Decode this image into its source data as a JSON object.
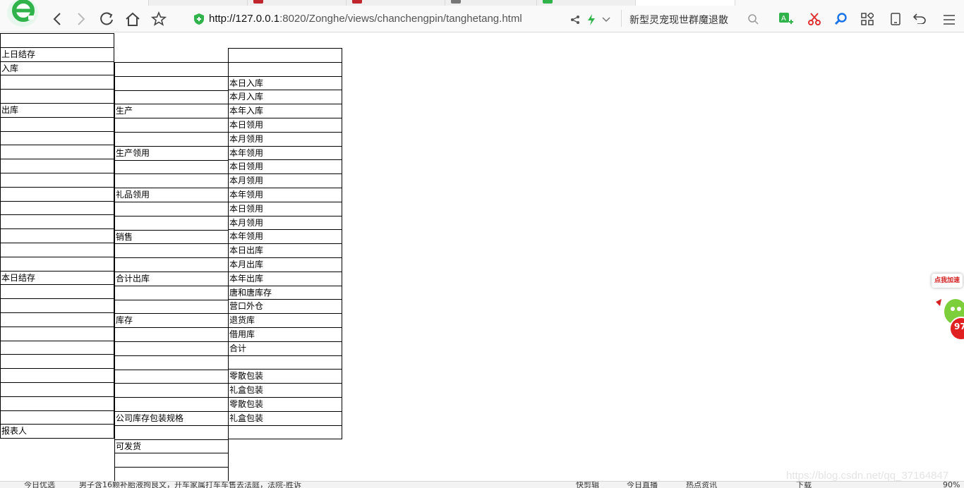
{
  "browser": {
    "url_prefix": "http://127.0.0.1",
    "url_rest": ":8020/Zonghe/views/chanchengpin/tanghetang.html",
    "search_text": "新型灵宠现世群魔退散",
    "icons": [
      "logo-e-icon",
      "back-icon",
      "forward-icon",
      "refresh-icon",
      "home-icon",
      "star-icon",
      "shield-icon",
      "share-icon",
      "bolt-icon",
      "chevron-down-icon",
      "search-icon",
      "translate-icon",
      "scissors-icon",
      "magnifier-icon",
      "apps-icon",
      "tablet-icon",
      "undo-icon",
      "menu-icon"
    ],
    "accent": "#2fb34a"
  },
  "table": {
    "col1": [
      "",
      "上日结存",
      "入库",
      "",
      "",
      "出库",
      "",
      "",
      "",
      "",
      "",
      "",
      "",
      "",
      "",
      "",
      "",
      "本日结存",
      "",
      "",
      "",
      "",
      "",
      "",
      "",
      "",
      "",
      "",
      "报表人"
    ],
    "col2": [
      "",
      "",
      "",
      "生产",
      "",
      "",
      "生产领用",
      "",
      "",
      "礼品领用",
      "",
      "",
      "销售",
      "",
      "",
      "合计出库",
      "",
      "",
      "库存",
      "",
      "",
      "",
      "",
      "",
      "",
      "公司库存包装规格",
      "",
      "可发货",
      "",
      ""
    ],
    "col3": [
      "",
      "",
      "本日入库",
      "本月入库",
      "本年入库",
      "本日领用",
      "本月领用",
      "本年领用",
      "本日领用",
      "本月领用",
      "本年领用",
      "本日领用",
      "本月领用",
      "本年领用",
      "本日出库",
      "本月出库",
      "本年出库",
      "唐和唐库存",
      "营口外仓",
      "退货库",
      "借用库",
      "合计",
      "",
      "零散包装",
      "礼盒包装",
      "零散包装",
      "礼盒包装",
      ""
    ]
  },
  "widget": {
    "badge": "点我加速",
    "count": "97"
  },
  "watermark": "https://blog.csdn.net/qq_37164847",
  "statusbar": {
    "left1": "今日优选",
    "left2": "男子含16颗补胎液拘良文，开车家属打车车售去法庭，法院-胜诉",
    "r1": "快剪辑",
    "r2": "今日直播",
    "r3": "热点资讯",
    "r4": "下载",
    "zoom": "90%"
  }
}
